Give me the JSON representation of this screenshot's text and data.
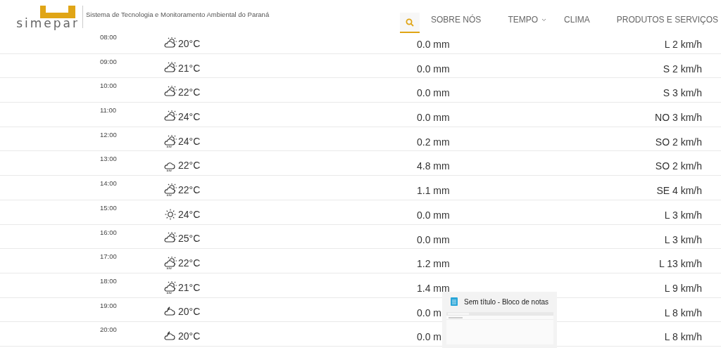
{
  "header": {
    "logo": "simepar",
    "tagline": "Sistema de Tecnologia e Monitoramento Ambiental do Paraná",
    "nav": [
      {
        "kind": "search",
        "selected": true
      },
      {
        "kind": "link",
        "label": "SOBRE NÓS",
        "selected": false
      },
      {
        "kind": "dropdown",
        "label": "TEMPO",
        "selected": false
      },
      {
        "kind": "link",
        "label": "CLIMA",
        "selected": false
      },
      {
        "kind": "link",
        "label": "PRODUTOS E SERVIÇOS",
        "selected": false
      }
    ]
  },
  "forecast": [
    {
      "time": "08:00",
      "kind": "partly-cloudy",
      "temp": "20°C",
      "rain": "0.0 mm",
      "wind": "L 2 km/h"
    },
    {
      "time": "09:00",
      "kind": "partly-cloudy",
      "temp": "21°C",
      "rain": "0.0 mm",
      "wind": "S 2 km/h"
    },
    {
      "time": "10:00",
      "kind": "partly-cloudy",
      "temp": "22°C",
      "rain": "0.0 mm",
      "wind": "S 3 km/h"
    },
    {
      "time": "11:00",
      "kind": "partly-cloudy",
      "temp": "24°C",
      "rain": "0.0 mm",
      "wind": "NO 3 km/h"
    },
    {
      "time": "12:00",
      "kind": "partly-cloudy-rain",
      "temp": "24°C",
      "rain": "0.2 mm",
      "wind": "SO 2 km/h"
    },
    {
      "time": "13:00",
      "kind": "rain",
      "temp": "22°C",
      "rain": "4.8 mm",
      "wind": "SO 2 km/h"
    },
    {
      "time": "14:00",
      "kind": "partly-cloudy-rain",
      "temp": "22°C",
      "rain": "1.1 mm",
      "wind": "SE 4 km/h"
    },
    {
      "time": "15:00",
      "kind": "sunny",
      "temp": "24°C",
      "rain": "0.0 mm",
      "wind": "L 3 km/h"
    },
    {
      "time": "16:00",
      "kind": "sun-behind-cloud",
      "temp": "25°C",
      "rain": "0.0 mm",
      "wind": "L 3 km/h"
    },
    {
      "time": "17:00",
      "kind": "partly-cloudy-rain",
      "temp": "22°C",
      "rain": "1.2 mm",
      "wind": "L 13 km/h"
    },
    {
      "time": "18:00",
      "kind": "rain-sun",
      "temp": "21°C",
      "rain": "1.4 mm",
      "wind": "L 9 km/h"
    },
    {
      "time": "19:00",
      "kind": "night-cloudy",
      "temp": "20°C",
      "rain": "0.0 m",
      "wind": "L 8 km/h"
    },
    {
      "time": "20:00",
      "kind": "night-cloudy",
      "temp": "20°C",
      "rain": "0.0 m",
      "wind": "L 8 km/h"
    }
  ],
  "taskbar_preview": {
    "title": "Sem título - Bloco de notas"
  }
}
